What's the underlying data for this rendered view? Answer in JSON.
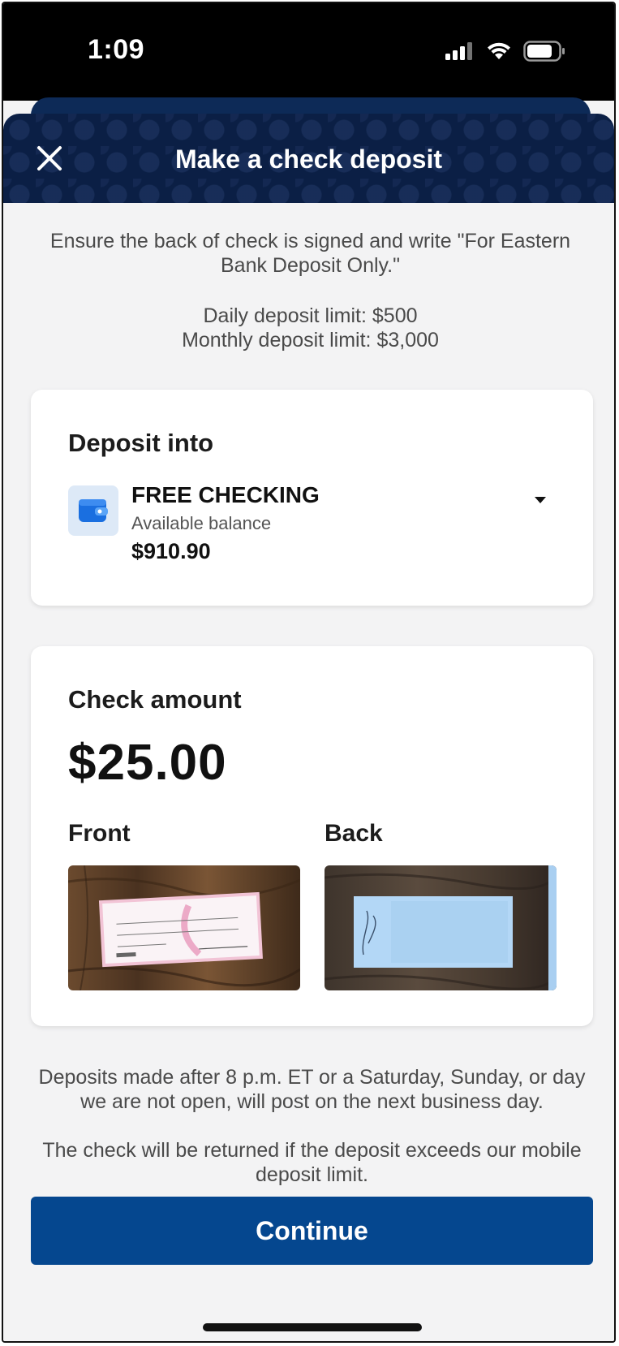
{
  "status_bar": {
    "time": "1:09"
  },
  "header": {
    "title": "Make a check deposit"
  },
  "info": {
    "instruction": "Ensure the back of check is signed and write \"For Eastern Bank Deposit Only.\"",
    "daily_limit": "Daily deposit limit: $500",
    "monthly_limit": "Monthly deposit limit: $3,000"
  },
  "deposit_card": {
    "heading": "Deposit into",
    "account_name": "FREE CHECKING",
    "balance_label": "Available balance",
    "balance": "$910.90"
  },
  "check_card": {
    "heading": "Check amount",
    "amount": "$25.00",
    "front_label": "Front",
    "back_label": "Back"
  },
  "notes": {
    "posting": "Deposits made after 8 p.m. ET or a Saturday, Sunday, or day we are not open, will post on the next business day.",
    "limit": "The check will be returned if the deposit exceeds our mobile deposit limit."
  },
  "actions": {
    "continue_label": "Continue"
  },
  "colors": {
    "primary": "#05478f",
    "header_bg": "#0b1f45",
    "page_bg": "#f3f3f4"
  }
}
